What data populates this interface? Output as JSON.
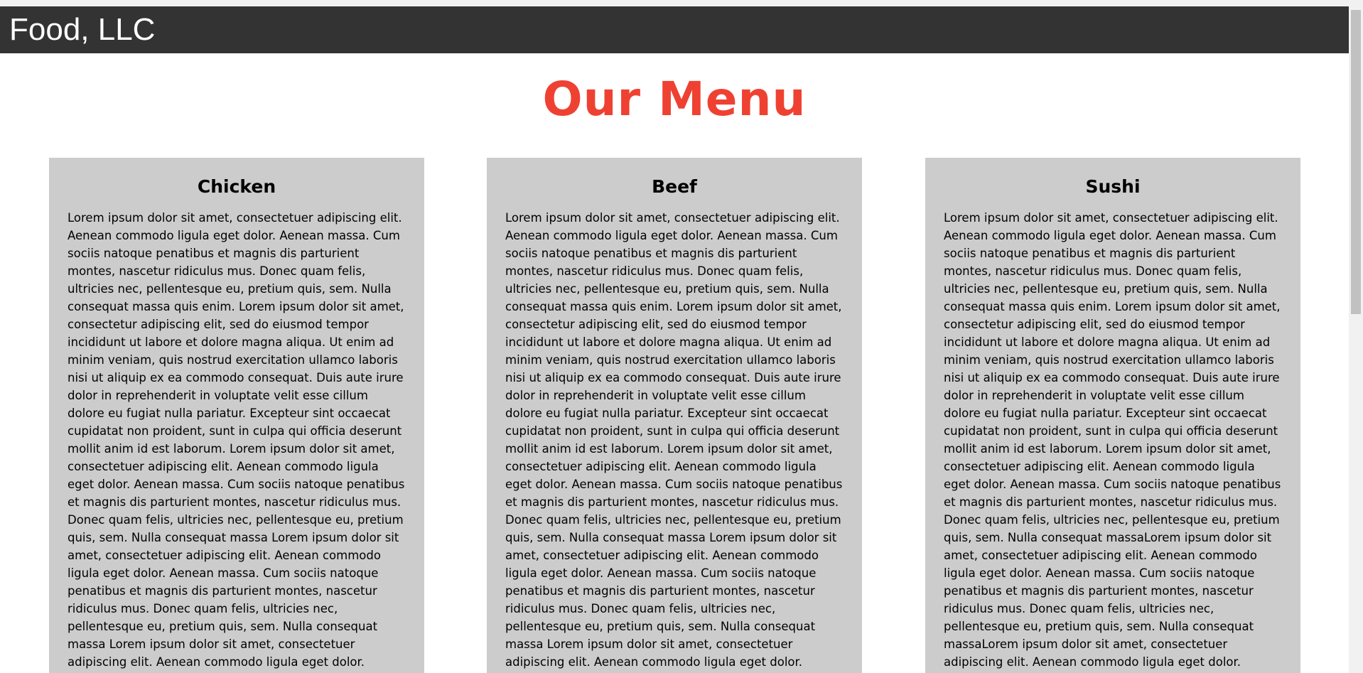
{
  "header": {
    "brand": "Food, LLC"
  },
  "main": {
    "title": "Our Menu",
    "sections": [
      {
        "heading": "Chicken",
        "text": "Lorem ipsum dolor sit amet, consectetuer adipiscing elit. Aenean commodo ligula eget dolor. Aenean massa. Cum sociis natoque penatibus et magnis dis parturient montes, nascetur ridiculus mus. Donec quam felis, ultricies nec, pellentesque eu, pretium quis, sem. Nulla consequat massa quis enim. Lorem ipsum dolor sit amet, consectetur adipiscing elit, sed do eiusmod tempor incididunt ut labore et dolore magna aliqua. Ut enim ad minim veniam, quis nostrud exercitation ullamco laboris nisi ut aliquip ex ea commodo consequat. Duis aute irure dolor in reprehenderit in voluptate velit esse cillum dolore eu fugiat nulla pariatur. Excepteur sint occaecat cupidatat non proident, sunt in culpa qui officia deserunt mollit anim id est laborum. Lorem ipsum dolor sit amet, consectetuer adipiscing elit. Aenean commodo ligula eget dolor. Aenean massa. Cum sociis natoque penatibus et magnis dis parturient montes, nascetur ridiculus mus. Donec quam felis, ultricies nec, pellentesque eu, pretium quis, sem. Nulla consequat massa Lorem ipsum dolor sit amet, consectetuer adipiscing elit. Aenean commodo ligula eget dolor. Aenean massa. Cum sociis natoque penatibus et magnis dis parturient montes, nascetur ridiculus mus. Donec quam felis, ultricies nec, pellentesque eu, pretium quis, sem. Nulla consequat massa Lorem ipsum dolor sit amet, consectetuer adipiscing elit. Aenean commodo ligula eget dolor. Aenean"
      },
      {
        "heading": "Beef",
        "text": "Lorem ipsum dolor sit amet, consectetuer adipiscing elit. Aenean commodo ligula eget dolor. Aenean massa. Cum sociis natoque penatibus et magnis dis parturient montes, nascetur ridiculus mus. Donec quam felis, ultricies nec, pellentesque eu, pretium quis, sem. Nulla consequat massa quis enim. Lorem ipsum dolor sit amet, consectetur adipiscing elit, sed do eiusmod tempor incididunt ut labore et dolore magna aliqua. Ut enim ad minim veniam, quis nostrud exercitation ullamco laboris nisi ut aliquip ex ea commodo consequat. Duis aute irure dolor in reprehenderit in voluptate velit esse cillum dolore eu fugiat nulla pariatur. Excepteur sint occaecat cupidatat non proident, sunt in culpa qui officia deserunt mollit anim id est laborum. Lorem ipsum dolor sit amet, consectetuer adipiscing elit. Aenean commodo ligula eget dolor. Aenean massa. Cum sociis natoque penatibus et magnis dis parturient montes, nascetur ridiculus mus. Donec quam felis, ultricies nec, pellentesque eu, pretium quis, sem. Nulla consequat massa Lorem ipsum dolor sit amet, consectetuer adipiscing elit. Aenean commodo ligula eget dolor. Aenean massa. Cum sociis natoque penatibus et magnis dis parturient montes, nascetur ridiculus mus. Donec quam felis, ultricies nec, pellentesque eu, pretium quis, sem. Nulla consequat massa Lorem ipsum dolor sit amet, consectetuer adipiscing elit. Aenean commodo ligula eget dolor. Aenean"
      },
      {
        "heading": "Sushi",
        "text": "Lorem ipsum dolor sit amet, consectetuer adipiscing elit. Aenean commodo ligula eget dolor. Aenean massa. Cum sociis natoque penatibus et magnis dis parturient montes, nascetur ridiculus mus. Donec quam felis, ultricies nec, pellentesque eu, pretium quis, sem. Nulla consequat massa quis enim. Lorem ipsum dolor sit amet, consectetur adipiscing elit, sed do eiusmod tempor incididunt ut labore et dolore magna aliqua. Ut enim ad minim veniam, quis nostrud exercitation ullamco laboris nisi ut aliquip ex ea commodo consequat. Duis aute irure dolor in reprehenderit in voluptate velit esse cillum dolore eu fugiat nulla pariatur. Excepteur sint occaecat cupidatat non proident, sunt in culpa qui officia deserunt mollit anim id est laborum. Lorem ipsum dolor sit amet, consectetuer adipiscing elit. Aenean commodo ligula eget dolor. Aenean massa. Cum sociis natoque penatibus et magnis dis parturient montes, nascetur ridiculus mus. Donec quam felis, ultricies nec, pellentesque eu, pretium quis, sem. Nulla consequat massaLorem ipsum dolor sit amet, consectetuer adipiscing elit. Aenean commodo ligula eget dolor. Aenean massa. Cum sociis natoque penatibus et magnis dis parturient montes, nascetur ridiculus mus. Donec quam felis, ultricies nec, pellentesque eu, pretium quis, sem. Nulla consequat massaLorem ipsum dolor sit amet, consectetuer adipiscing elit. Aenean commodo ligula eget dolor. Aenean"
      }
    ]
  },
  "colors": {
    "header_bg": "#333333",
    "title": "#ef4132",
    "section_bg": "#cccccc"
  }
}
